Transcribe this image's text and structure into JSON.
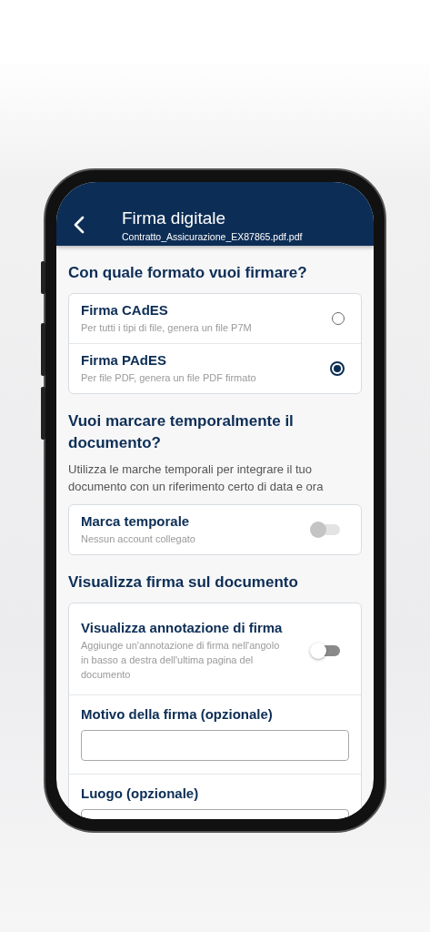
{
  "header": {
    "title": "Firma digitale",
    "subtitle": "Contratto_Assicurazione_EX87865.pdf.pdf"
  },
  "format": {
    "heading": "Con quale formato vuoi firmare?",
    "options": [
      {
        "title": "Firma CAdES",
        "description": "Per tutti i tipi di file, genera un file P7M",
        "selected": false
      },
      {
        "title": "Firma PAdES",
        "description": "Per file PDF, genera un file PDF firmato",
        "selected": true
      }
    ]
  },
  "timestamp": {
    "heading": "Vuoi marcare temporalmente il documento?",
    "description": "Utilizza le marche temporali per integrare il tuo documento con un riferimento certo di data e ora",
    "toggle": {
      "title": "Marca temporale",
      "description": "Nessun account collegato",
      "on": false,
      "disabled": true
    }
  },
  "visualize": {
    "heading": "Visualizza firma sul documento",
    "toggle": {
      "title": "Visualizza annotazione di firma",
      "description": "Aggiunge un'annotazione di firma nell'angolo in basso a destra dell'ultima pagina del documento",
      "on": false,
      "disabled": false
    },
    "fields": [
      {
        "label": "Motivo della firma (opzionale)"
      },
      {
        "label": "Luogo (opzionale)"
      }
    ]
  }
}
